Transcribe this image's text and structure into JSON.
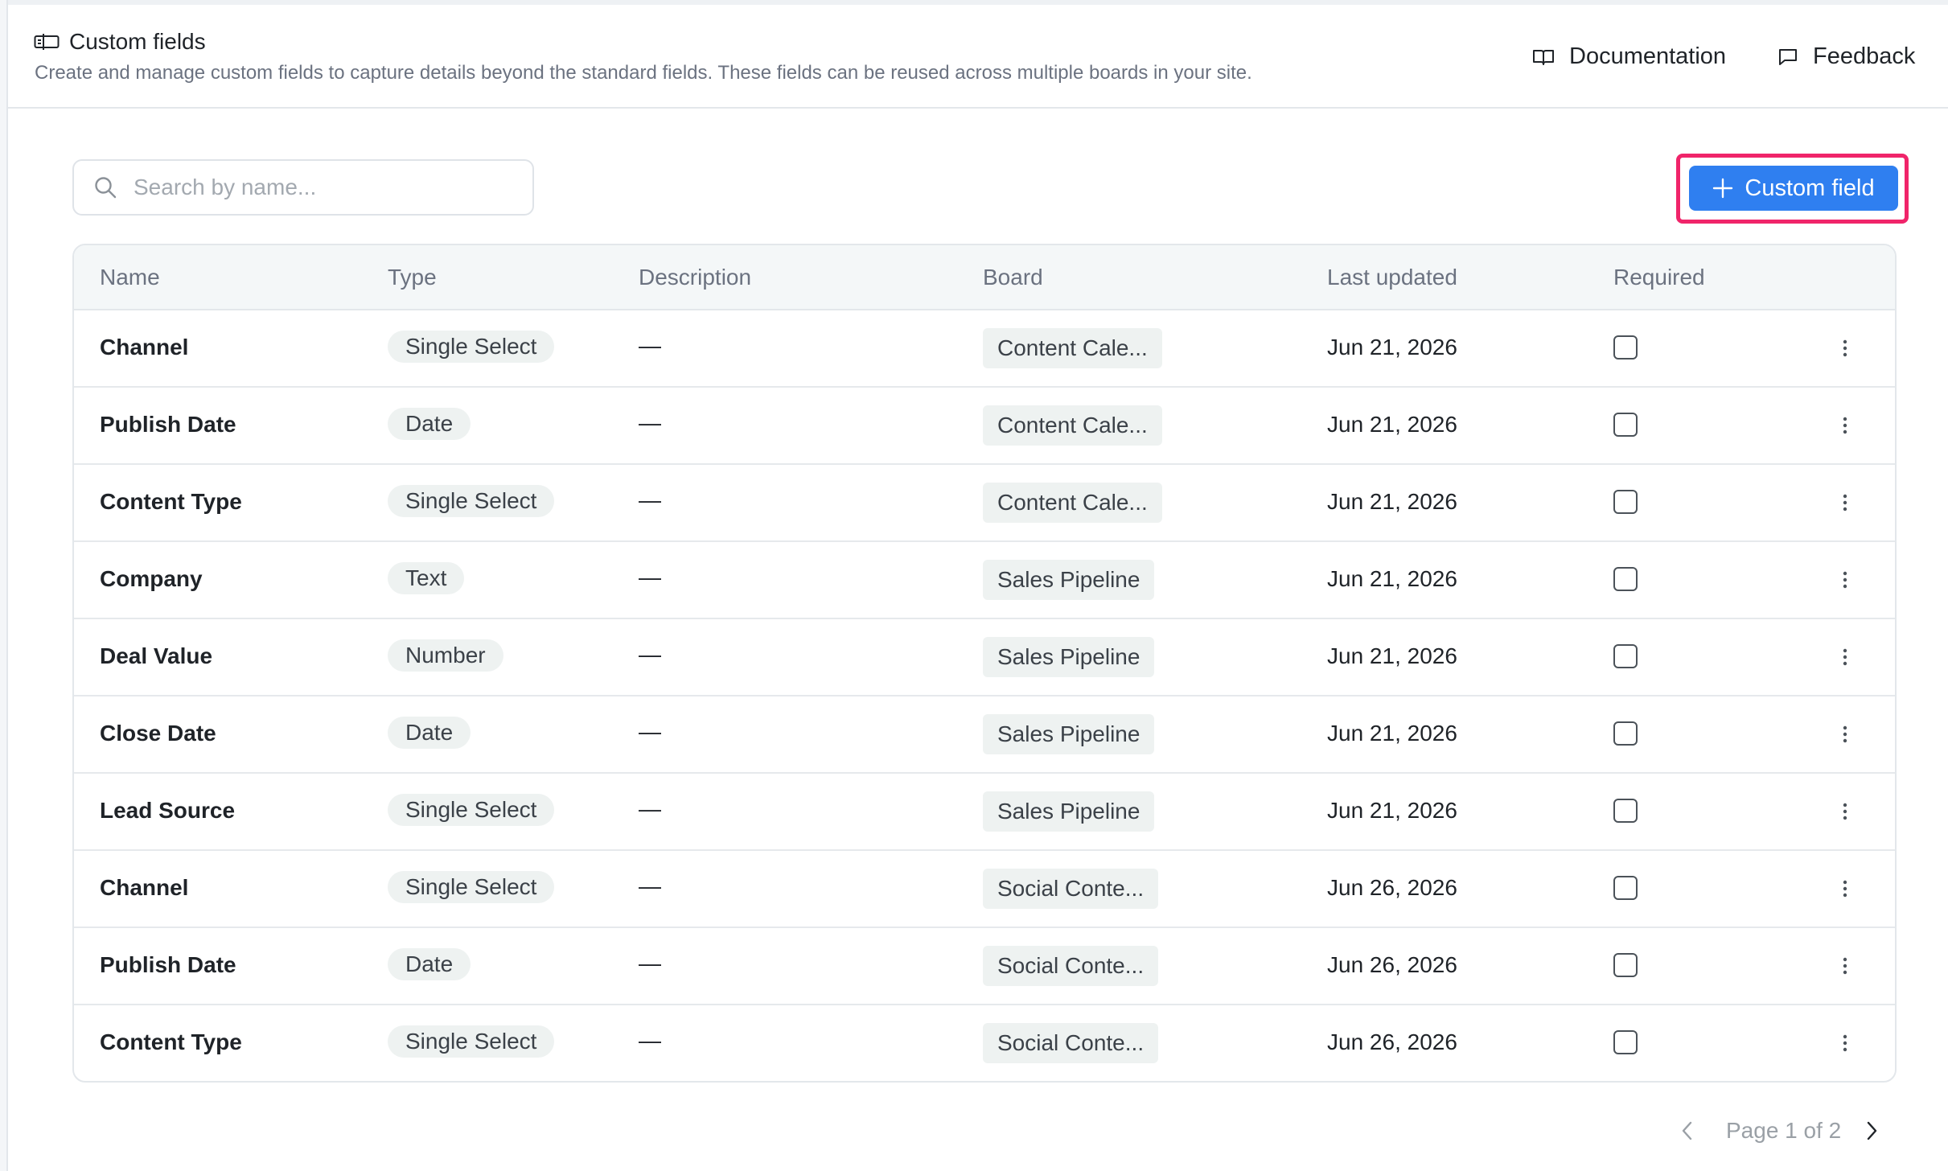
{
  "header": {
    "title": "Custom fields",
    "subtitle": "Create and manage custom fields to capture details beyond the standard fields. These fields can be reused across multiple boards in your site.",
    "documentation_label": "Documentation",
    "feedback_label": "Feedback"
  },
  "search": {
    "placeholder": "Search by name...",
    "value": ""
  },
  "add_button": {
    "label": "Custom field"
  },
  "table": {
    "columns": [
      "Name",
      "Type",
      "Description",
      "Board",
      "Last updated",
      "Required"
    ],
    "rows": [
      {
        "name": "Channel",
        "type": "Single Select",
        "description": "—",
        "board": "Content Cale...",
        "updated": "Jun 21, 2026",
        "required": false
      },
      {
        "name": "Publish Date",
        "type": "Date",
        "description": "—",
        "board": "Content Cale...",
        "updated": "Jun 21, 2026",
        "required": false
      },
      {
        "name": "Content Type",
        "type": "Single Select",
        "description": "—",
        "board": "Content Cale...",
        "updated": "Jun 21, 2026",
        "required": false
      },
      {
        "name": "Company",
        "type": "Text",
        "description": "—",
        "board": "Sales Pipeline",
        "updated": "Jun 21, 2026",
        "required": false
      },
      {
        "name": "Deal Value",
        "type": "Number",
        "description": "—",
        "board": "Sales Pipeline",
        "updated": "Jun 21, 2026",
        "required": false
      },
      {
        "name": "Close Date",
        "type": "Date",
        "description": "—",
        "board": "Sales Pipeline",
        "updated": "Jun 21, 2026",
        "required": false
      },
      {
        "name": "Lead Source",
        "type": "Single Select",
        "description": "—",
        "board": "Sales Pipeline",
        "updated": "Jun 21, 2026",
        "required": false
      },
      {
        "name": "Channel",
        "type": "Single Select",
        "description": "—",
        "board": "Social Conte...",
        "updated": "Jun 26, 2026",
        "required": false
      },
      {
        "name": "Publish Date",
        "type": "Date",
        "description": "—",
        "board": "Social Conte...",
        "updated": "Jun 26, 2026",
        "required": false
      },
      {
        "name": "Content Type",
        "type": "Single Select",
        "description": "—",
        "board": "Social Conte...",
        "updated": "Jun 26, 2026",
        "required": false
      }
    ]
  },
  "pagination": {
    "label": "Page 1 of 2",
    "current_page": 1,
    "total_pages": 2
  },
  "colors": {
    "accent": "#2f7ff0",
    "highlight": "#f0246a",
    "pill_background": "#eef2f1",
    "header_background": "#f4f7f8"
  },
  "icons": {
    "title": "custom-fields-icon",
    "documentation": "book-icon",
    "feedback": "message-icon",
    "search": "search-icon",
    "add": "plus-icon",
    "row_menu": "more-vertical-icon",
    "prev": "chevron-left-icon",
    "next": "chevron-right-icon"
  }
}
